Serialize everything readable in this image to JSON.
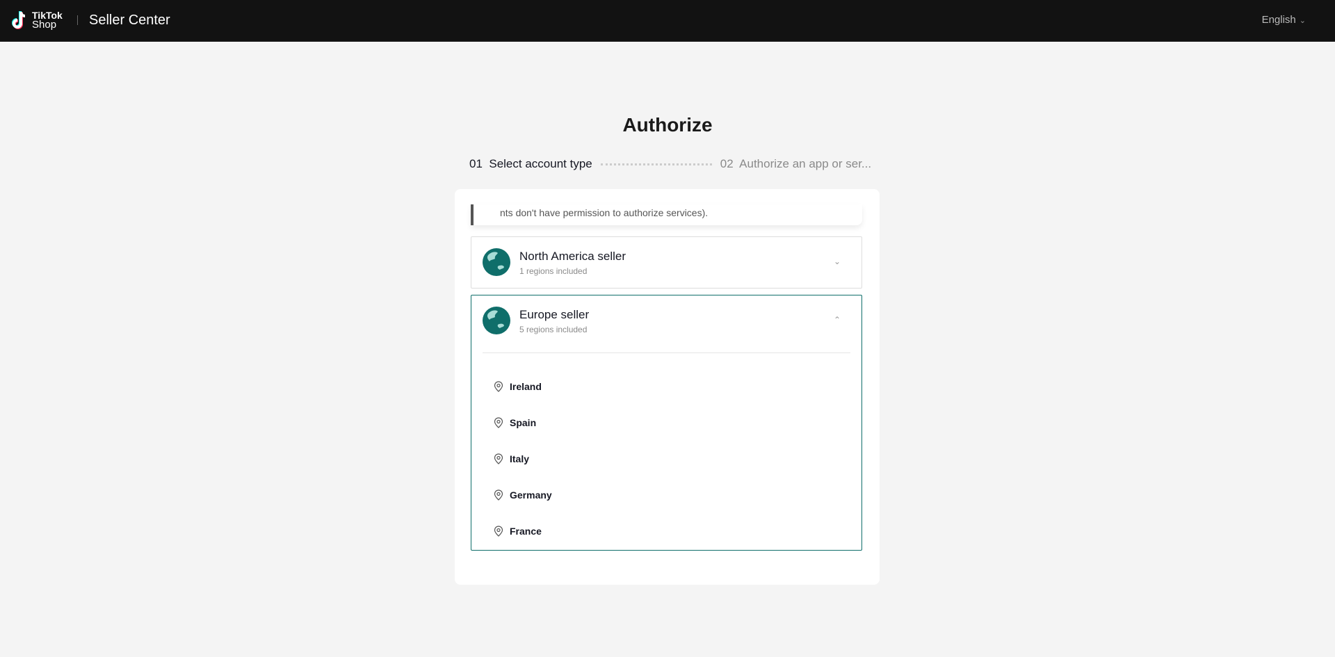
{
  "header": {
    "logo_line1": "TikTok",
    "logo_line2": "Shop",
    "app_title": "Seller Center",
    "language": "English"
  },
  "page": {
    "title": "Authorize"
  },
  "steps": [
    {
      "label": "01  Select account type"
    },
    {
      "label": "02  Authorize an app or ser..."
    }
  ],
  "notice": {
    "text": "nts don't have permission to authorize services)."
  },
  "accounts": [
    {
      "title": "North America seller",
      "subtitle": "1 regions included",
      "expanded": false
    },
    {
      "title": "Europe seller",
      "subtitle": "5 regions included",
      "expanded": true,
      "regions": [
        "Ireland",
        "Spain",
        "Italy",
        "Germany",
        "France"
      ]
    }
  ],
  "colors": {
    "accent": "#0f6e6a",
    "header_bg": "#121212"
  }
}
